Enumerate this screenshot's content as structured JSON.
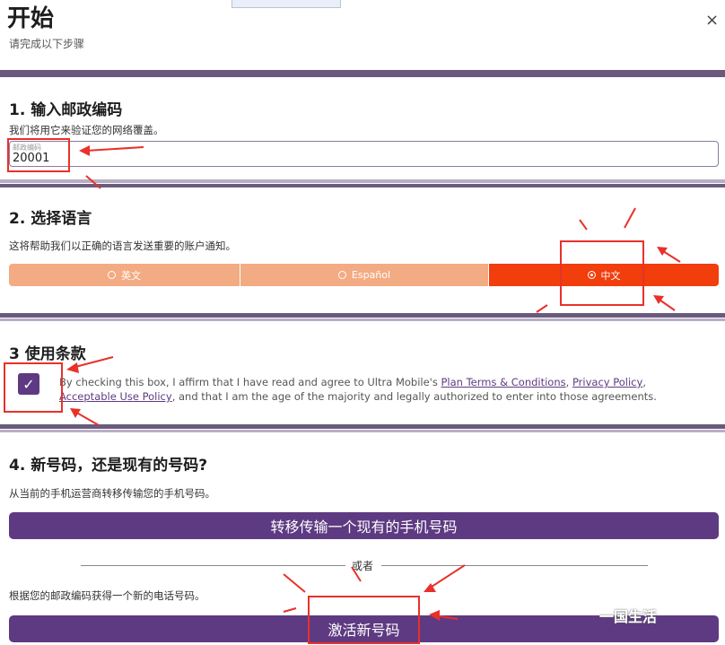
{
  "header": {
    "title": "开始",
    "subtitle": "请完成以下步骤",
    "close_glyph": "×"
  },
  "step1": {
    "heading": "1. 输入邮政编码",
    "description": "我们将用它来验证您的网络覆盖。",
    "zip_label": "邮政编码",
    "zip_value": "20001"
  },
  "step2": {
    "heading": "2. 选择语言",
    "description": "这将帮助我们以正确的语言发送重要的账户通知。",
    "options": [
      {
        "label": "英文",
        "selected": false
      },
      {
        "label": "Español",
        "selected": false
      },
      {
        "label": "中文",
        "selected": true
      }
    ]
  },
  "step3": {
    "heading": "3 使用条款",
    "checked": true,
    "text_before": "By checking this box, I affirm that I have read and agree to Ultra Mobile's ",
    "link_plan": "Plan Terms & Conditions",
    "sep1": ", ",
    "link_privacy": "Privacy Policy",
    "sep2": ", ",
    "link_aup": "Acceptable Use Policy",
    "text_after": ", and that I am the age of the majority and legally authorized to enter into those agreements."
  },
  "step4": {
    "heading": "4. 新号码，还是现有的号码?",
    "description": "从当前的手机运营商转移传输您的手机号码。",
    "transfer_button": "转移传输一个现有的手机号码",
    "or_label": "或者",
    "new_description": "根据您的邮政编码获得一个新的电话号码。",
    "activate_button": "激活新号码"
  },
  "watermark": "一国生活",
  "colors": {
    "purple": "#5e3a82",
    "orange_light": "#f3ab83",
    "orange_active": "#f23d0c",
    "annotation_red": "#e8312a"
  }
}
